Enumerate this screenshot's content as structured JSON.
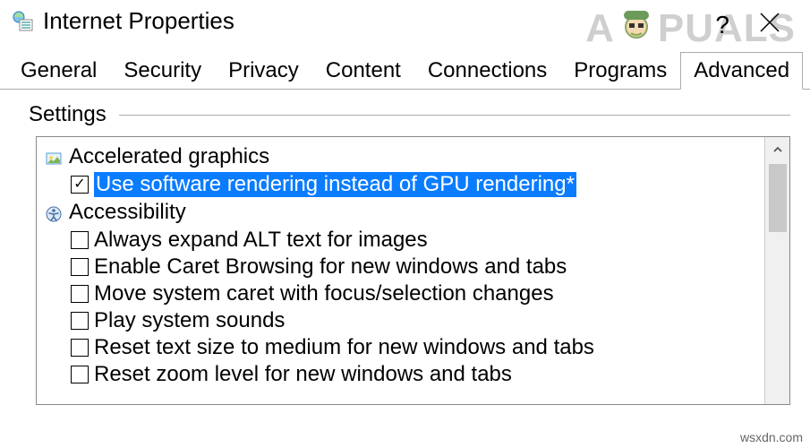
{
  "window": {
    "title": "Internet Properties"
  },
  "watermark": {
    "prefix": "A",
    "suffix": "PUALS"
  },
  "tabs": [
    {
      "label": "General"
    },
    {
      "label": "Security"
    },
    {
      "label": "Privacy"
    },
    {
      "label": "Content"
    },
    {
      "label": "Connections"
    },
    {
      "label": "Programs"
    },
    {
      "label": "Advanced"
    }
  ],
  "active_tab_index": 6,
  "group_label": "Settings",
  "sections": [
    {
      "icon": "graphics",
      "label": "Accelerated graphics",
      "items": [
        {
          "checked": true,
          "selected": true,
          "label": "Use software rendering instead of GPU rendering*"
        }
      ]
    },
    {
      "icon": "accessibility",
      "label": "Accessibility",
      "items": [
        {
          "checked": false,
          "selected": false,
          "label": "Always expand ALT text for images"
        },
        {
          "checked": false,
          "selected": false,
          "label": "Enable Caret Browsing for new windows and tabs"
        },
        {
          "checked": false,
          "selected": false,
          "label": "Move system caret with focus/selection changes"
        },
        {
          "checked": false,
          "selected": false,
          "label": "Play system sounds"
        },
        {
          "checked": false,
          "selected": false,
          "label": "Reset text size to medium for new windows and tabs"
        },
        {
          "checked": false,
          "selected": false,
          "label": "Reset zoom level for new windows and tabs"
        }
      ]
    }
  ],
  "source_tag": "wsxdn.com",
  "help_symbol": "?"
}
